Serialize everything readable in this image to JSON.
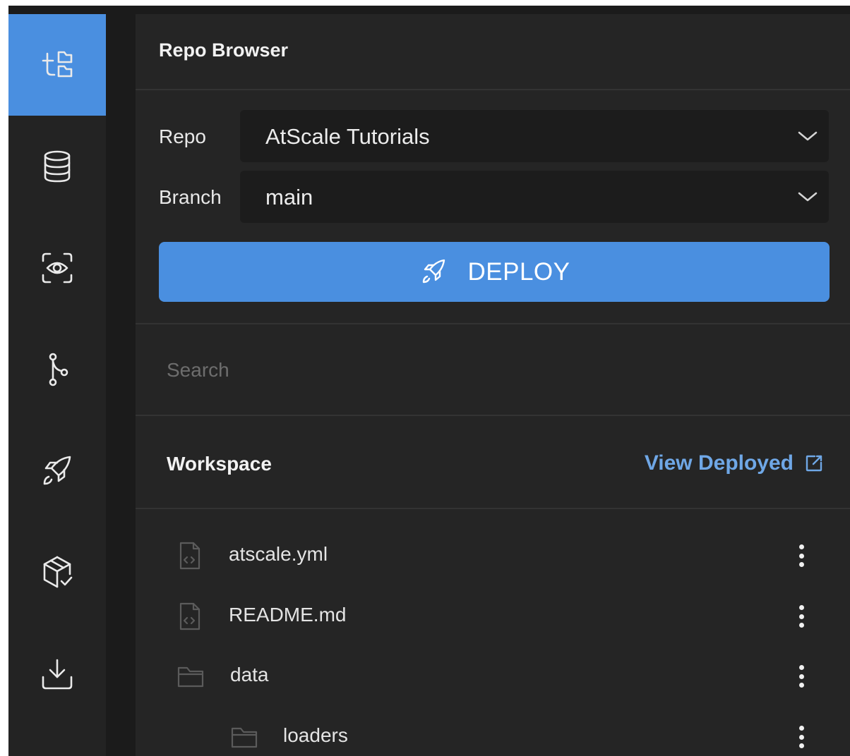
{
  "rail": {
    "items": [
      {
        "icon": "repo-tree-icon",
        "active": true
      },
      {
        "icon": "database-icon",
        "active": false
      },
      {
        "icon": "eye-scan-icon",
        "active": false
      },
      {
        "icon": "git-branch-icon",
        "active": false
      },
      {
        "icon": "rocket-icon",
        "active": false
      },
      {
        "icon": "package-check-icon",
        "active": false
      },
      {
        "icon": "download-icon",
        "active": false
      }
    ]
  },
  "panel": {
    "title": "Repo Browser",
    "repo": {
      "label": "Repo",
      "value": "AtScale Tutorials"
    },
    "branch": {
      "label": "Branch",
      "value": "main"
    },
    "deploy_label": "DEPLOY",
    "search": {
      "placeholder": "Search",
      "value": ""
    },
    "workspace": {
      "title": "Workspace",
      "view_deployed_label": "View Deployed"
    },
    "tree": [
      {
        "name": "atscale.yml",
        "type": "file",
        "depth": 0
      },
      {
        "name": "README.md",
        "type": "file",
        "depth": 0
      },
      {
        "name": "data",
        "type": "folder",
        "depth": 0
      },
      {
        "name": "loaders",
        "type": "folder",
        "depth": 1
      }
    ]
  },
  "colors": {
    "accent": "#4a8fe0",
    "link": "#6fa7e6",
    "rail_bg": "#232323",
    "panel_bg": "#252525"
  }
}
